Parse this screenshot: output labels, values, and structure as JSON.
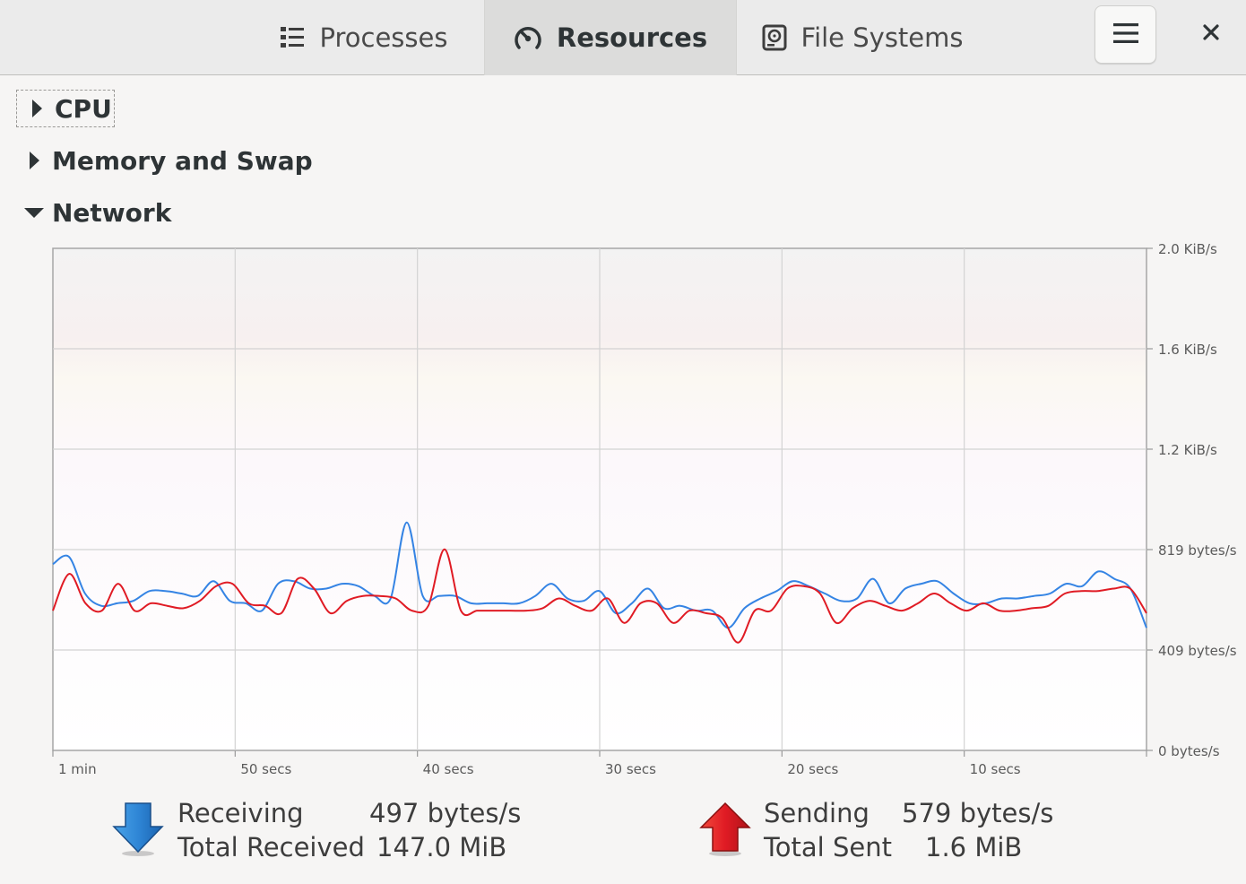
{
  "header": {
    "tabs": [
      {
        "label": "Processes",
        "icon": "list-icon",
        "active": false
      },
      {
        "label": "Resources",
        "icon": "gauge-icon",
        "active": true
      },
      {
        "label": "File Systems",
        "icon": "disk-icon",
        "active": false
      }
    ],
    "menu_icon": "hamburger-icon",
    "close_icon": "close-icon"
  },
  "sections": {
    "cpu": {
      "label": "CPU",
      "expanded": false
    },
    "memory": {
      "label": "Memory and Swap",
      "expanded": false
    },
    "network": {
      "label": "Network",
      "expanded": true
    }
  },
  "chart_data": {
    "type": "line",
    "x_ticks": [
      "1 min",
      "50 secs",
      "40 secs",
      "30 secs",
      "20 secs",
      "10 secs"
    ],
    "y_ticks": [
      "2.0 KiB/s",
      "1.6 KiB/s",
      "1.2 KiB/s",
      "819 bytes/s",
      "409 bytes/s",
      "0 bytes/s"
    ],
    "x_range_seconds_ago": [
      60,
      0
    ],
    "ylim_bytes_per_s": [
      0,
      2048
    ],
    "grid": true,
    "series": [
      {
        "color": "#3584e4",
        "values": [
          760,
          790,
          640,
          590,
          600,
          610,
          650,
          650,
          640,
          630,
          690,
          610,
          600,
          570,
          680,
          690,
          660,
          660,
          680,
          670,
          630,
          620,
          930,
          630,
          630,
          630,
          600,
          600,
          600,
          600,
          630,
          680,
          620,
          610,
          650,
          560,
          600,
          660,
          580,
          590,
          570,
          570,
          500,
          580,
          620,
          650,
          690,
          670,
          640,
          610,
          620,
          700,
          600,
          660,
          680,
          690,
          640,
          600,
          600,
          620,
          620,
          630,
          640,
          680,
          670,
          730,
          700,
          660,
          500
        ]
      },
      {
        "color": "#e01b24",
        "values": [
          570,
          720,
          600,
          570,
          680,
          570,
          600,
          590,
          580,
          610,
          670,
          680,
          600,
          590,
          560,
          700,
          660,
          560,
          610,
          630,
          630,
          620,
          570,
          590,
          820,
          570,
          570,
          570,
          570,
          570,
          580,
          620,
          590,
          570,
          620,
          520,
          600,
          600,
          520,
          570,
          560,
          540,
          440,
          570,
          570,
          660,
          670,
          640,
          520,
          580,
          610,
          590,
          570,
          600,
          640,
          600,
          570,
          600,
          570,
          570,
          580,
          590,
          640,
          650,
          650,
          660,
          660,
          560
        ]
      }
    ]
  },
  "stats": {
    "receiving": {
      "icon": "download-arrow-icon",
      "color": "#3584e4",
      "rate_label": "Receiving",
      "rate_value": "497 bytes/s",
      "total_label": "Total Received",
      "total_value": "147.0 MiB"
    },
    "sending": {
      "icon": "upload-arrow-icon",
      "color": "#e01b24",
      "rate_label": "Sending",
      "rate_value": "579 bytes/s",
      "total_label": "Total Sent",
      "total_value": "1.6 MiB"
    }
  }
}
